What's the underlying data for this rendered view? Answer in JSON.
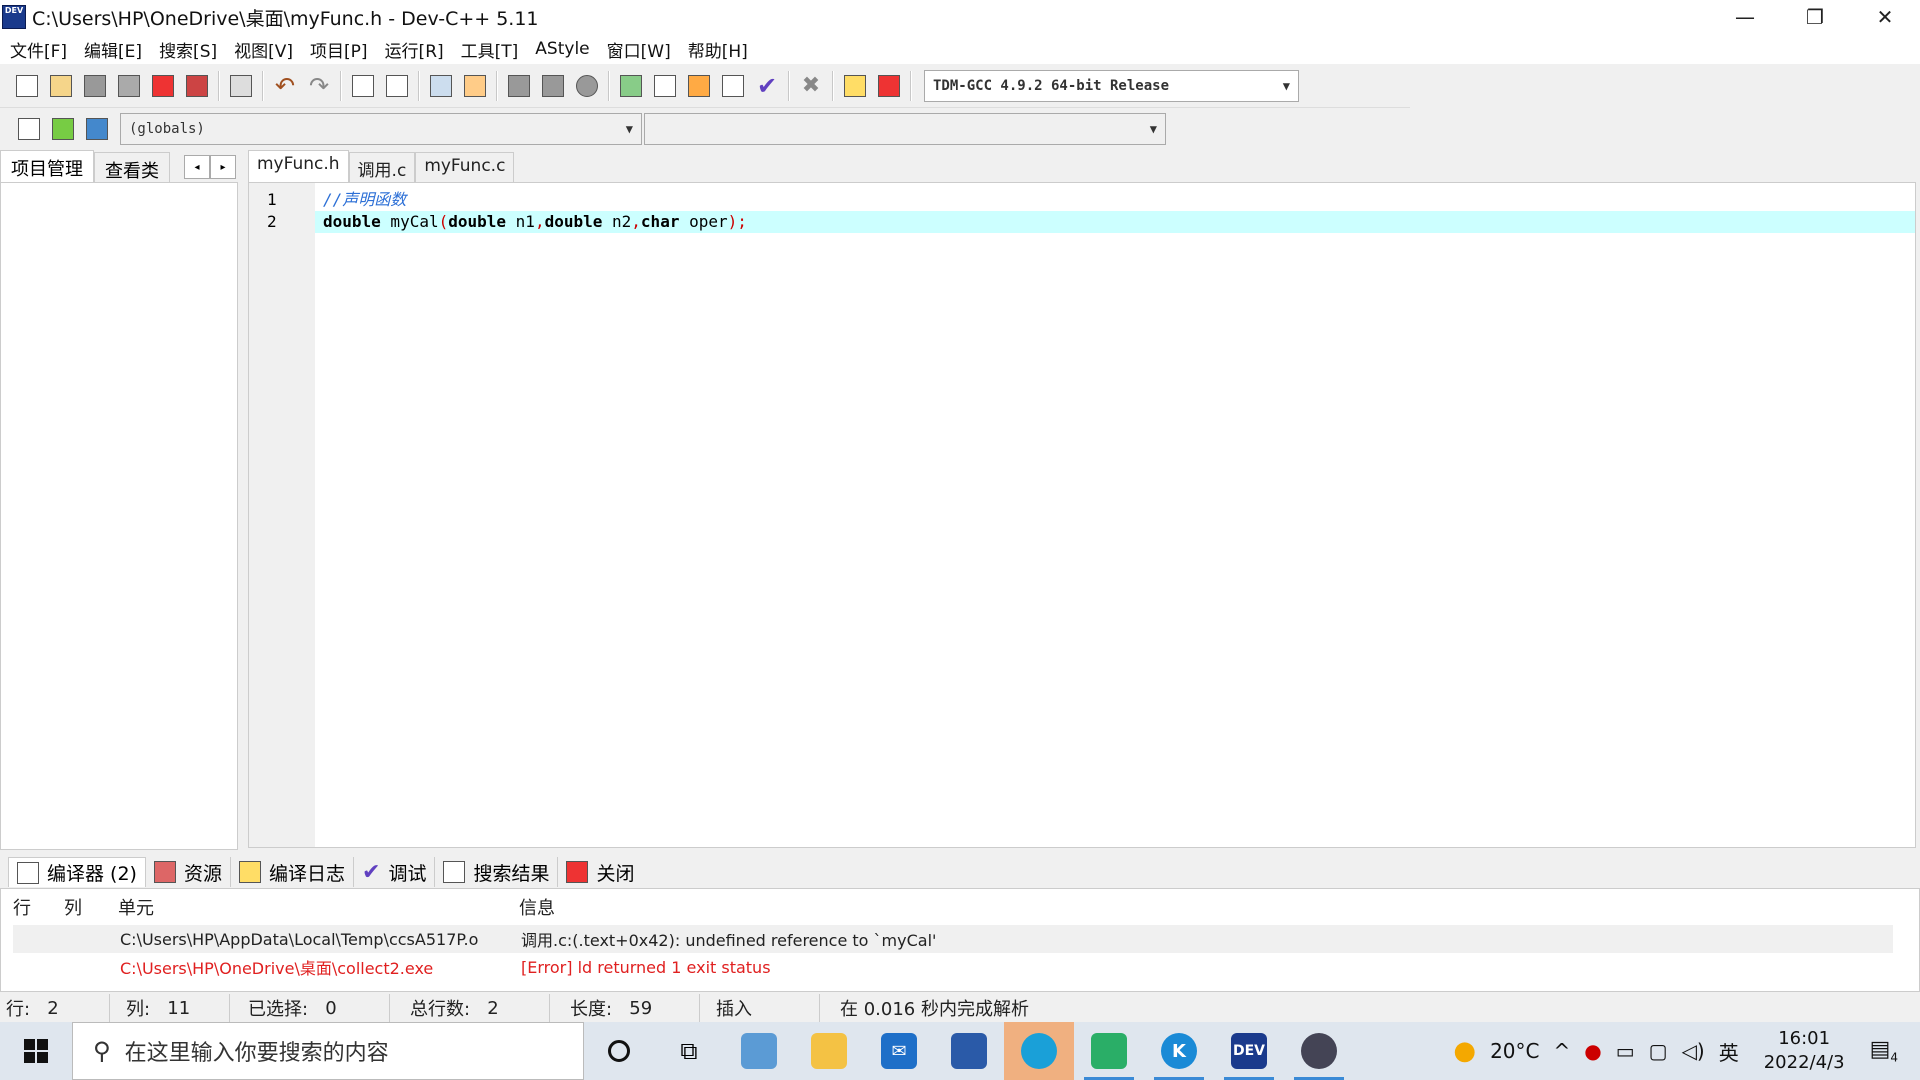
{
  "window": {
    "title": "C:\\Users\\HP\\OneDrive\\桌面\\myFunc.h - Dev-C++ 5.11",
    "app_icon_label": "DEV",
    "minimize": "—",
    "restore": "❐",
    "close": "✕"
  },
  "menu": [
    "文件[F]",
    "编辑[E]",
    "搜索[S]",
    "视图[V]",
    "项目[P]",
    "运行[R]",
    "工具[T]",
    "AStyle",
    "窗口[W]",
    "帮助[H]"
  ],
  "toolbar": {
    "compiler": "TDM-GCC 4.9.2 64-bit Release",
    "scope_select": "(globals)",
    "symbol_select": ""
  },
  "left_panel": {
    "tabs": [
      "项目管理",
      "查看类"
    ],
    "nav_prev": "◂",
    "nav_next": "▸"
  },
  "editor": {
    "tabs": [
      "myFunc.h",
      "调用.c",
      "myFunc.c"
    ],
    "lines": [
      {
        "num": "1",
        "comment": "//声明函数"
      },
      {
        "num": "2",
        "t1": "double",
        "t2": " myCal",
        "t3": "(",
        "t4": "double",
        "t5": " n1",
        "t6": ",",
        "t7": "double",
        "t8": " n2",
        "t9": ",",
        "t10": "char",
        "t11": " oper",
        "t12": ");"
      }
    ]
  },
  "bottom": {
    "tabs": [
      "编译器 (2)",
      "资源",
      "编译日志",
      "调试",
      "搜索结果",
      "关闭"
    ],
    "headers": {
      "line": "行",
      "col": "列",
      "unit": "单元",
      "message": "信息"
    },
    "rows": [
      {
        "line": "",
        "col": "",
        "unit": "C:\\Users\\HP\\AppData\\Local\\Temp\\ccsA517P.o",
        "message": "调用.c:(.text+0x42): undefined reference to `myCal'",
        "error": false
      },
      {
        "line": "",
        "col": "",
        "unit": "C:\\Users\\HP\\OneDrive\\桌面\\collect2.exe",
        "message": "[Error] ld returned 1 exit status",
        "error": true
      }
    ]
  },
  "status": {
    "row_label": "行:",
    "row": "2",
    "col_label": "列:",
    "col": "11",
    "sel_label": "已选择:",
    "sel": "0",
    "total_label": "总行数:",
    "total": "2",
    "len_label": "长度:",
    "len": "59",
    "mode": "插入",
    "parse": "在 0.016 秒内完成解析"
  },
  "taskbar": {
    "search_placeholder": "在这里输入你要搜索的内容",
    "weather": "20°C",
    "ime": "英",
    "time": "16:01",
    "date": "2022/4/3",
    "notif_count": "4",
    "dev_label": "DEV"
  }
}
